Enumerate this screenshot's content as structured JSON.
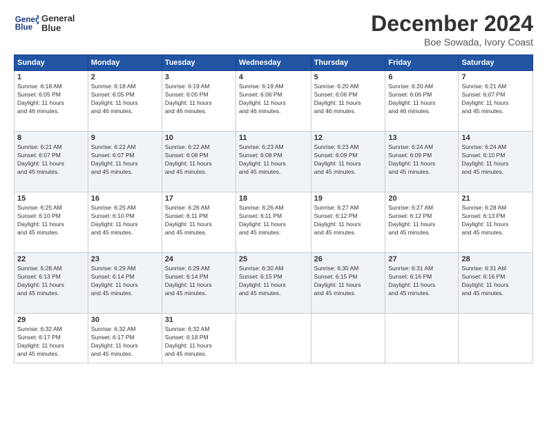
{
  "header": {
    "logo_line1": "General",
    "logo_line2": "Blue",
    "title": "December 2024",
    "location": "Boe Sowada, Ivory Coast"
  },
  "days_of_week": [
    "Sunday",
    "Monday",
    "Tuesday",
    "Wednesday",
    "Thursday",
    "Friday",
    "Saturday"
  ],
  "weeks": [
    [
      {
        "day": "1",
        "info": "Sunrise: 6:18 AM\nSunset: 6:05 PM\nDaylight: 11 hours\nand 46 minutes."
      },
      {
        "day": "2",
        "info": "Sunrise: 6:18 AM\nSunset: 6:05 PM\nDaylight: 11 hours\nand 46 minutes."
      },
      {
        "day": "3",
        "info": "Sunrise: 6:19 AM\nSunset: 6:05 PM\nDaylight: 11 hours\nand 46 minutes."
      },
      {
        "day": "4",
        "info": "Sunrise: 6:19 AM\nSunset: 6:06 PM\nDaylight: 11 hours\nand 46 minutes."
      },
      {
        "day": "5",
        "info": "Sunrise: 6:20 AM\nSunset: 6:06 PM\nDaylight: 11 hours\nand 46 minutes."
      },
      {
        "day": "6",
        "info": "Sunrise: 6:20 AM\nSunset: 6:06 PM\nDaylight: 11 hours\nand 46 minutes."
      },
      {
        "day": "7",
        "info": "Sunrise: 6:21 AM\nSunset: 6:07 PM\nDaylight: 11 hours\nand 45 minutes."
      }
    ],
    [
      {
        "day": "8",
        "info": "Sunrise: 6:21 AM\nSunset: 6:07 PM\nDaylight: 11 hours\nand 45 minutes."
      },
      {
        "day": "9",
        "info": "Sunrise: 6:22 AM\nSunset: 6:07 PM\nDaylight: 11 hours\nand 45 minutes."
      },
      {
        "day": "10",
        "info": "Sunrise: 6:22 AM\nSunset: 6:08 PM\nDaylight: 11 hours\nand 45 minutes."
      },
      {
        "day": "11",
        "info": "Sunrise: 6:23 AM\nSunset: 6:08 PM\nDaylight: 11 hours\nand 45 minutes."
      },
      {
        "day": "12",
        "info": "Sunrise: 6:23 AM\nSunset: 6:09 PM\nDaylight: 11 hours\nand 45 minutes."
      },
      {
        "day": "13",
        "info": "Sunrise: 6:24 AM\nSunset: 6:09 PM\nDaylight: 11 hours\nand 45 minutes."
      },
      {
        "day": "14",
        "info": "Sunrise: 6:24 AM\nSunset: 6:10 PM\nDaylight: 11 hours\nand 45 minutes."
      }
    ],
    [
      {
        "day": "15",
        "info": "Sunrise: 6:25 AM\nSunset: 6:10 PM\nDaylight: 11 hours\nand 45 minutes."
      },
      {
        "day": "16",
        "info": "Sunrise: 6:25 AM\nSunset: 6:10 PM\nDaylight: 11 hours\nand 45 minutes."
      },
      {
        "day": "17",
        "info": "Sunrise: 6:26 AM\nSunset: 6:11 PM\nDaylight: 11 hours\nand 45 minutes."
      },
      {
        "day": "18",
        "info": "Sunrise: 6:26 AM\nSunset: 6:11 PM\nDaylight: 11 hours\nand 45 minutes."
      },
      {
        "day": "19",
        "info": "Sunrise: 6:27 AM\nSunset: 6:12 PM\nDaylight: 11 hours\nand 45 minutes."
      },
      {
        "day": "20",
        "info": "Sunrise: 6:27 AM\nSunset: 6:12 PM\nDaylight: 11 hours\nand 45 minutes."
      },
      {
        "day": "21",
        "info": "Sunrise: 6:28 AM\nSunset: 6:13 PM\nDaylight: 11 hours\nand 45 minutes."
      }
    ],
    [
      {
        "day": "22",
        "info": "Sunrise: 6:28 AM\nSunset: 6:13 PM\nDaylight: 11 hours\nand 45 minutes."
      },
      {
        "day": "23",
        "info": "Sunrise: 6:29 AM\nSunset: 6:14 PM\nDaylight: 11 hours\nand 45 minutes."
      },
      {
        "day": "24",
        "info": "Sunrise: 6:29 AM\nSunset: 6:14 PM\nDaylight: 11 hours\nand 45 minutes."
      },
      {
        "day": "25",
        "info": "Sunrise: 6:30 AM\nSunset: 6:15 PM\nDaylight: 11 hours\nand 45 minutes."
      },
      {
        "day": "26",
        "info": "Sunrise: 6:30 AM\nSunset: 6:15 PM\nDaylight: 11 hours\nand 45 minutes."
      },
      {
        "day": "27",
        "info": "Sunrise: 6:31 AM\nSunset: 6:16 PM\nDaylight: 11 hours\nand 45 minutes."
      },
      {
        "day": "28",
        "info": "Sunrise: 6:31 AM\nSunset: 6:16 PM\nDaylight: 11 hours\nand 45 minutes."
      }
    ],
    [
      {
        "day": "29",
        "info": "Sunrise: 6:32 AM\nSunset: 6:17 PM\nDaylight: 11 hours\nand 45 minutes."
      },
      {
        "day": "30",
        "info": "Sunrise: 6:32 AM\nSunset: 6:17 PM\nDaylight: 11 hours\nand 45 minutes."
      },
      {
        "day": "31",
        "info": "Sunrise: 6:32 AM\nSunset: 6:18 PM\nDaylight: 11 hours\nand 45 minutes."
      },
      {
        "day": "",
        "info": ""
      },
      {
        "day": "",
        "info": ""
      },
      {
        "day": "",
        "info": ""
      },
      {
        "day": "",
        "info": ""
      }
    ]
  ]
}
